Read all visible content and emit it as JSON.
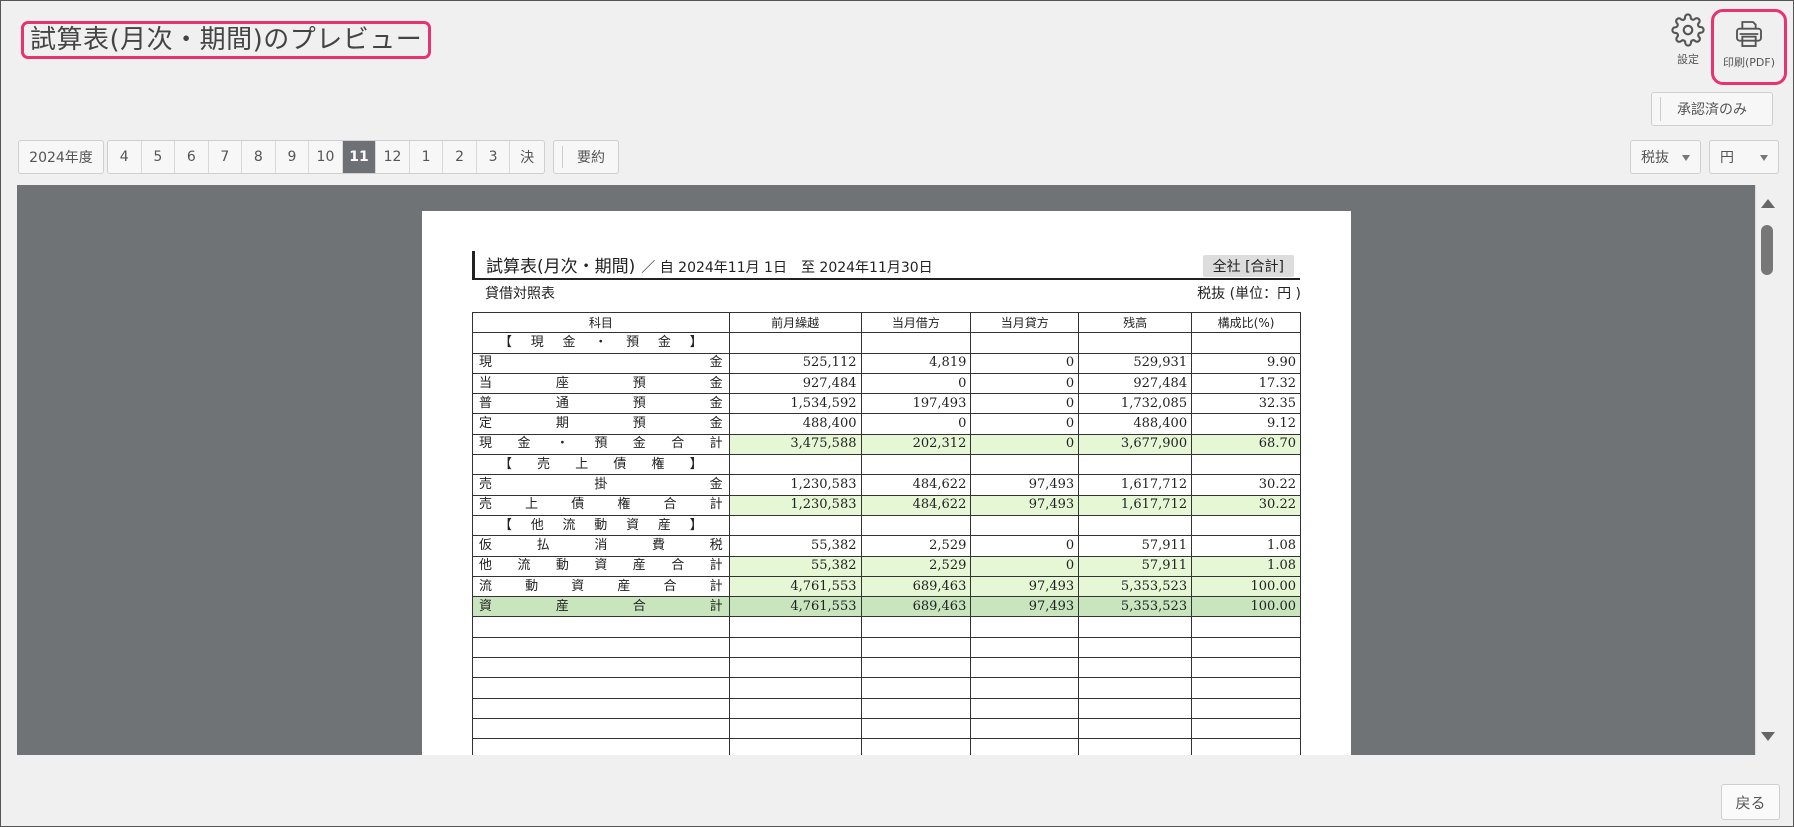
{
  "header": {
    "title": "試算表(月次・期間)のプレビュー",
    "settings_label": "設定",
    "print_label": "印刷(PDF)",
    "approved_label": "承認済のみ"
  },
  "toolbar": {
    "year_label": "2024年度",
    "months": [
      "4",
      "5",
      "6",
      "7",
      "8",
      "9",
      "10",
      "11",
      "12",
      "1",
      "2",
      "3",
      "決"
    ],
    "active_month": "11",
    "summary_label": "要約",
    "tax_select": "税抜",
    "unit_select": "円"
  },
  "report": {
    "title": "試算表(月次・期間)",
    "period": "／ 自 2024年11月 1日　至 2024年11月30日",
    "scope_badge": "全社 [合計]",
    "subtitle": "貸借対照表",
    "unit_note": "税抜 (単位：円 )",
    "columns": [
      "科目",
      "前月繰越",
      "当月借方",
      "当月貸方",
      "残高",
      "構成比(%)"
    ],
    "rows": [
      {
        "type": "section",
        "account": [
          "【",
          "現",
          "金",
          "・",
          "預",
          "金",
          "】"
        ],
        "values": [
          "",
          "",
          "",
          "",
          ""
        ]
      },
      {
        "type": "item",
        "account": [
          "現",
          "金"
        ],
        "values": [
          "525,112",
          "4,819",
          "0",
          "529,931",
          "9.90"
        ]
      },
      {
        "type": "item",
        "account": [
          "当",
          "座",
          "預",
          "金"
        ],
        "values": [
          "927,484",
          "0",
          "0",
          "927,484",
          "17.32"
        ]
      },
      {
        "type": "item",
        "account": [
          "普",
          "通",
          "預",
          "金"
        ],
        "values": [
          "1,534,592",
          "197,493",
          "0",
          "1,732,085",
          "32.35"
        ]
      },
      {
        "type": "item",
        "account": [
          "定",
          "期",
          "預",
          "金"
        ],
        "values": [
          "488,400",
          "0",
          "0",
          "488,400",
          "9.12"
        ]
      },
      {
        "type": "total",
        "account": [
          "現",
          "金",
          "・",
          "預",
          "金",
          "合",
          "計"
        ],
        "values": [
          "3,475,588",
          "202,312",
          "0",
          "3,677,900",
          "68.70"
        ]
      },
      {
        "type": "section",
        "account": [
          "【",
          "売",
          "上",
          "債",
          "権",
          "】"
        ],
        "values": [
          "",
          "",
          "",
          "",
          ""
        ]
      },
      {
        "type": "item",
        "account": [
          "売",
          "掛",
          "金"
        ],
        "values": [
          "1,230,583",
          "484,622",
          "97,493",
          "1,617,712",
          "30.22"
        ]
      },
      {
        "type": "total",
        "account": [
          "売",
          "上",
          "債",
          "権",
          "合",
          "計"
        ],
        "values": [
          "1,230,583",
          "484,622",
          "97,493",
          "1,617,712",
          "30.22"
        ]
      },
      {
        "type": "section",
        "account": [
          "【",
          "他",
          "流",
          "動",
          "資",
          "産",
          "】"
        ],
        "values": [
          "",
          "",
          "",
          "",
          ""
        ]
      },
      {
        "type": "item",
        "account": [
          "仮",
          "払",
          "消",
          "費",
          "税"
        ],
        "values": [
          "55,382",
          "2,529",
          "0",
          "57,911",
          "1.08"
        ]
      },
      {
        "type": "total",
        "account": [
          "他",
          "流",
          "動",
          "資",
          "産",
          "合",
          "計"
        ],
        "values": [
          "55,382",
          "2,529",
          "0",
          "57,911",
          "1.08"
        ]
      },
      {
        "type": "total",
        "account": [
          "流",
          "動",
          "資",
          "産",
          "合",
          "計"
        ],
        "values": [
          "4,761,553",
          "689,463",
          "97,493",
          "5,353,523",
          "100.00"
        ]
      },
      {
        "type": "grand",
        "account": [
          "資",
          "産",
          "合",
          "計"
        ],
        "values": [
          "4,761,553",
          "689,463",
          "97,493",
          "5,353,523",
          "100.00"
        ]
      }
    ],
    "empty_rows": 7
  },
  "footer": {
    "back_label": "戻る"
  },
  "colors": {
    "highlight": "#e8336e",
    "total_row": "#e5f7d5",
    "grand_row": "#c8e5be",
    "viewer_bg": "#707375"
  }
}
